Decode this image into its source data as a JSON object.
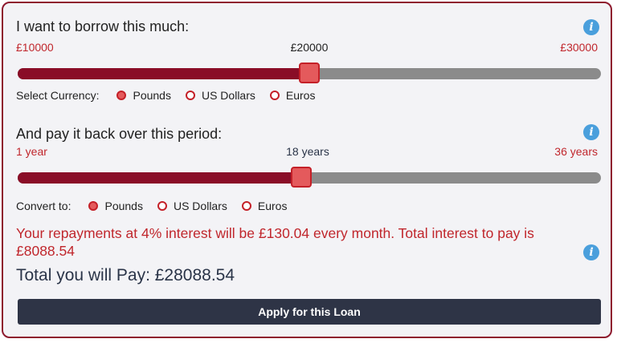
{
  "borrow": {
    "title": "I want to borrow this much:",
    "min_label": "£10000",
    "current_label": "£20000",
    "max_label": "£30000",
    "min": 10000,
    "max": 30000,
    "value": 20000,
    "currency_label": "Select Currency:",
    "currency_options": [
      "Pounds",
      "US Dollars",
      "Euros"
    ],
    "currency_selected": "Pounds"
  },
  "period": {
    "title": "And pay it back over this period:",
    "min_label": "1 year",
    "current_label": "18 years",
    "max_label": "36 years",
    "min": 1,
    "max": 36,
    "value": 18,
    "convert_label": "Convert to:",
    "convert_options": [
      "Pounds",
      "US Dollars",
      "Euros"
    ],
    "convert_selected": "Pounds"
  },
  "result": {
    "repayment_text": "Your repayments at 4% interest will be £130.04 every month. Total interest to pay is £8088.54",
    "total_text": "Total you will Pay: £28088.54"
  },
  "apply_label": "Apply for this Loan",
  "colors": {
    "accent": "#8a0d27",
    "thumb": "#e45a5c",
    "result_text": "#c0262c",
    "button_bg": "#2e3446",
    "info": "#4a9fdc"
  },
  "icons": {
    "info": "info-icon"
  }
}
